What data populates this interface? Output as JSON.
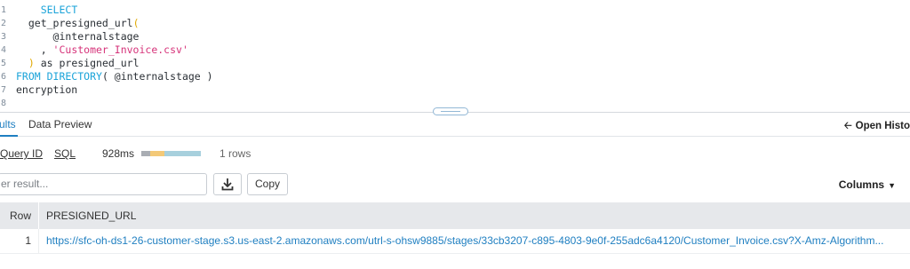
{
  "editor": {
    "lines": [
      {
        "n": "1",
        "parts": [
          {
            "t": "    ",
            "c": ""
          },
          {
            "t": "SELECT",
            "c": "kw"
          }
        ]
      },
      {
        "n": "2",
        "parts": [
          {
            "t": "  get_presigned_url",
            "c": "fn"
          },
          {
            "t": "(",
            "c": "paren"
          }
        ]
      },
      {
        "n": "3",
        "parts": [
          {
            "t": "      @internalstage",
            "c": "fn"
          }
        ]
      },
      {
        "n": "4",
        "parts": [
          {
            "t": "    , ",
            "c": "fn"
          },
          {
            "t": "'Customer_Invoice.csv'",
            "c": "str"
          }
        ]
      },
      {
        "n": "5",
        "parts": [
          {
            "t": "  ",
            "c": ""
          },
          {
            "t": ")",
            "c": "paren"
          },
          {
            "t": " as presigned_url",
            "c": "fn"
          }
        ]
      },
      {
        "n": "6",
        "parts": [
          {
            "t": "FROM DIRECTORY",
            "c": "kw"
          },
          {
            "t": "( @internalstage )",
            "c": "fn"
          }
        ]
      },
      {
        "n": "7",
        "parts": [
          {
            "t": "encryption",
            "c": "fn"
          }
        ]
      },
      {
        "n": "8",
        "parts": []
      }
    ]
  },
  "tabs": {
    "results": "ults",
    "data_preview": "Data Preview",
    "open_history": "Open Histo",
    "open_history_icon": "arrow-left-icon"
  },
  "info": {
    "query_id": "Query ID",
    "sql": "SQL",
    "duration": "928ms",
    "rows": "1 rows",
    "bar_colors": [
      "#a9adb3",
      "#f3c978",
      "#a7d0dd"
    ]
  },
  "filter": {
    "placeholder": "er result..."
  },
  "buttons": {
    "download_icon": "download-icon",
    "copy": "Copy",
    "columns": "Columns"
  },
  "table": {
    "headers": {
      "row": "Row",
      "presigned_url": "PRESIGNED_URL"
    },
    "rows": [
      {
        "row": "1",
        "presigned_url": "https://sfc-oh-ds1-26-customer-stage.s3.us-east-2.amazonaws.com/utrl-s-ohsw9885/stages/33cb3207-c895-4803-9e0f-255adc6a4120/Customer_Invoice.csv?X-Amz-Algorithm..."
      }
    ]
  }
}
